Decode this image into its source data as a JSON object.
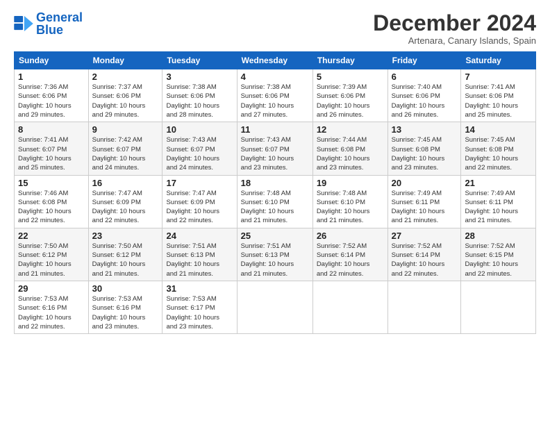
{
  "logo": {
    "text_general": "General",
    "text_blue": "Blue"
  },
  "title": "December 2024",
  "subtitle": "Artenara, Canary Islands, Spain",
  "header": {
    "days": [
      "Sunday",
      "Monday",
      "Tuesday",
      "Wednesday",
      "Thursday",
      "Friday",
      "Saturday"
    ]
  },
  "weeks": [
    {
      "row_index": 0,
      "cells": [
        {
          "day": "1",
          "info": "Sunrise: 7:36 AM\nSunset: 6:06 PM\nDaylight: 10 hours\nand 29 minutes."
        },
        {
          "day": "2",
          "info": "Sunrise: 7:37 AM\nSunset: 6:06 PM\nDaylight: 10 hours\nand 29 minutes."
        },
        {
          "day": "3",
          "info": "Sunrise: 7:38 AM\nSunset: 6:06 PM\nDaylight: 10 hours\nand 28 minutes."
        },
        {
          "day": "4",
          "info": "Sunrise: 7:38 AM\nSunset: 6:06 PM\nDaylight: 10 hours\nand 27 minutes."
        },
        {
          "day": "5",
          "info": "Sunrise: 7:39 AM\nSunset: 6:06 PM\nDaylight: 10 hours\nand 26 minutes."
        },
        {
          "day": "6",
          "info": "Sunrise: 7:40 AM\nSunset: 6:06 PM\nDaylight: 10 hours\nand 26 minutes."
        },
        {
          "day": "7",
          "info": "Sunrise: 7:41 AM\nSunset: 6:06 PM\nDaylight: 10 hours\nand 25 minutes."
        }
      ]
    },
    {
      "row_index": 1,
      "cells": [
        {
          "day": "8",
          "info": "Sunrise: 7:41 AM\nSunset: 6:07 PM\nDaylight: 10 hours\nand 25 minutes."
        },
        {
          "day": "9",
          "info": "Sunrise: 7:42 AM\nSunset: 6:07 PM\nDaylight: 10 hours\nand 24 minutes."
        },
        {
          "day": "10",
          "info": "Sunrise: 7:43 AM\nSunset: 6:07 PM\nDaylight: 10 hours\nand 24 minutes."
        },
        {
          "day": "11",
          "info": "Sunrise: 7:43 AM\nSunset: 6:07 PM\nDaylight: 10 hours\nand 23 minutes."
        },
        {
          "day": "12",
          "info": "Sunrise: 7:44 AM\nSunset: 6:08 PM\nDaylight: 10 hours\nand 23 minutes."
        },
        {
          "day": "13",
          "info": "Sunrise: 7:45 AM\nSunset: 6:08 PM\nDaylight: 10 hours\nand 23 minutes."
        },
        {
          "day": "14",
          "info": "Sunrise: 7:45 AM\nSunset: 6:08 PM\nDaylight: 10 hours\nand 22 minutes."
        }
      ]
    },
    {
      "row_index": 2,
      "cells": [
        {
          "day": "15",
          "info": "Sunrise: 7:46 AM\nSunset: 6:08 PM\nDaylight: 10 hours\nand 22 minutes."
        },
        {
          "day": "16",
          "info": "Sunrise: 7:47 AM\nSunset: 6:09 PM\nDaylight: 10 hours\nand 22 minutes."
        },
        {
          "day": "17",
          "info": "Sunrise: 7:47 AM\nSunset: 6:09 PM\nDaylight: 10 hours\nand 22 minutes."
        },
        {
          "day": "18",
          "info": "Sunrise: 7:48 AM\nSunset: 6:10 PM\nDaylight: 10 hours\nand 21 minutes."
        },
        {
          "day": "19",
          "info": "Sunrise: 7:48 AM\nSunset: 6:10 PM\nDaylight: 10 hours\nand 21 minutes."
        },
        {
          "day": "20",
          "info": "Sunrise: 7:49 AM\nSunset: 6:11 PM\nDaylight: 10 hours\nand 21 minutes."
        },
        {
          "day": "21",
          "info": "Sunrise: 7:49 AM\nSunset: 6:11 PM\nDaylight: 10 hours\nand 21 minutes."
        }
      ]
    },
    {
      "row_index": 3,
      "cells": [
        {
          "day": "22",
          "info": "Sunrise: 7:50 AM\nSunset: 6:12 PM\nDaylight: 10 hours\nand 21 minutes."
        },
        {
          "day": "23",
          "info": "Sunrise: 7:50 AM\nSunset: 6:12 PM\nDaylight: 10 hours\nand 21 minutes."
        },
        {
          "day": "24",
          "info": "Sunrise: 7:51 AM\nSunset: 6:13 PM\nDaylight: 10 hours\nand 21 minutes."
        },
        {
          "day": "25",
          "info": "Sunrise: 7:51 AM\nSunset: 6:13 PM\nDaylight: 10 hours\nand 21 minutes."
        },
        {
          "day": "26",
          "info": "Sunrise: 7:52 AM\nSunset: 6:14 PM\nDaylight: 10 hours\nand 22 minutes."
        },
        {
          "day": "27",
          "info": "Sunrise: 7:52 AM\nSunset: 6:14 PM\nDaylight: 10 hours\nand 22 minutes."
        },
        {
          "day": "28",
          "info": "Sunrise: 7:52 AM\nSunset: 6:15 PM\nDaylight: 10 hours\nand 22 minutes."
        }
      ]
    },
    {
      "row_index": 4,
      "cells": [
        {
          "day": "29",
          "info": "Sunrise: 7:53 AM\nSunset: 6:16 PM\nDaylight: 10 hours\nand 22 minutes."
        },
        {
          "day": "30",
          "info": "Sunrise: 7:53 AM\nSunset: 6:16 PM\nDaylight: 10 hours\nand 23 minutes."
        },
        {
          "day": "31",
          "info": "Sunrise: 7:53 AM\nSunset: 6:17 PM\nDaylight: 10 hours\nand 23 minutes."
        },
        {
          "day": "",
          "info": ""
        },
        {
          "day": "",
          "info": ""
        },
        {
          "day": "",
          "info": ""
        },
        {
          "day": "",
          "info": ""
        }
      ]
    }
  ]
}
